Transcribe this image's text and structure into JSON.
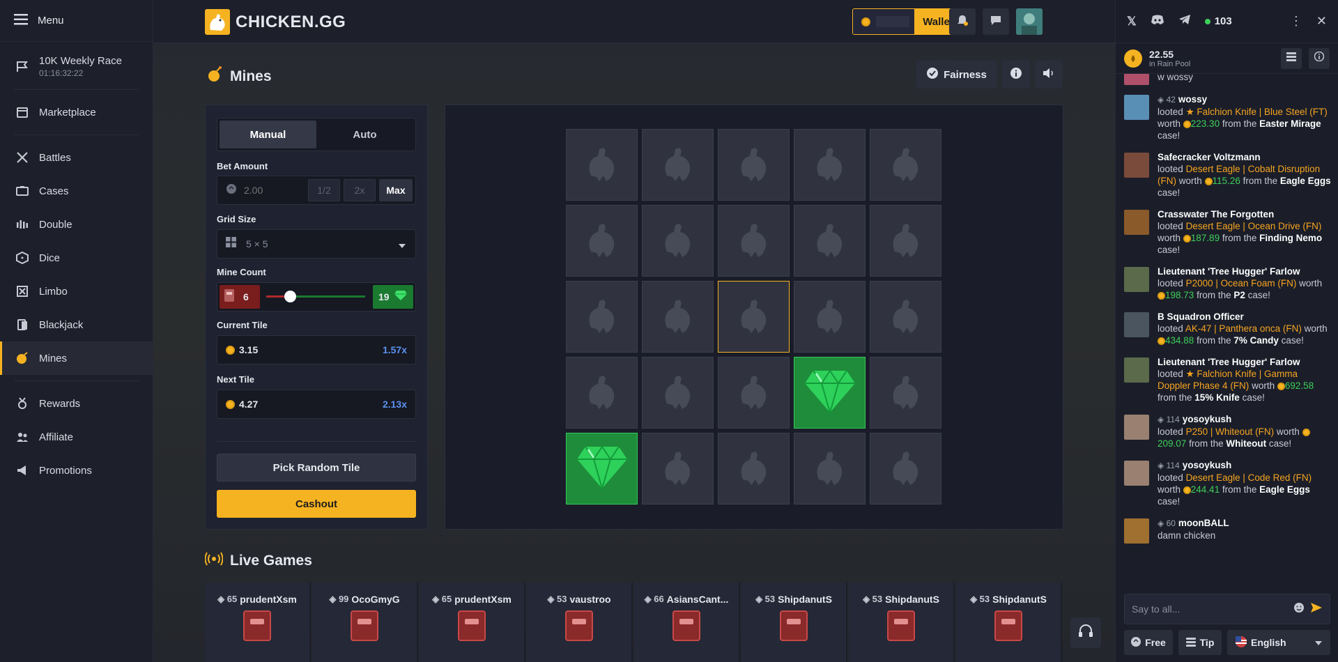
{
  "sidebar": {
    "menu_label": "Menu",
    "race": {
      "label": "10K Weekly Race",
      "timer": "01:16:32:22"
    },
    "items": [
      {
        "label": "Marketplace",
        "icon": "store-icon"
      },
      {
        "label": "Battles",
        "icon": "swords-icon"
      },
      {
        "label": "Cases",
        "icon": "case-icon"
      },
      {
        "label": "Double",
        "icon": "bars-icon"
      },
      {
        "label": "Dice",
        "icon": "dice-icon"
      },
      {
        "label": "Limbo",
        "icon": "limbo-icon"
      },
      {
        "label": "Blackjack",
        "icon": "cards-icon"
      },
      {
        "label": "Mines",
        "icon": "bomb-icon",
        "active": true
      },
      {
        "label": "Rewards",
        "icon": "medal-icon"
      },
      {
        "label": "Affiliate",
        "icon": "users-icon"
      },
      {
        "label": "Promotions",
        "icon": "megaphone-icon"
      }
    ]
  },
  "header": {
    "logo_text": "CHICKEN.GG",
    "wallet_label": "Wallet"
  },
  "game": {
    "title": "Mines",
    "fairness_label": "Fairness",
    "tabs": [
      "Manual",
      "Auto"
    ],
    "bet_label": "Bet Amount",
    "bet_placeholder": "2.00",
    "half_label": "1/2",
    "double_label": "2x",
    "max_label": "Max",
    "grid_label": "Grid Size",
    "grid_value": "5 × 5",
    "mine_label": "Mine Count",
    "mines": "6",
    "gems": "19",
    "mine_fraction": 0.24,
    "current_label": "Current Tile",
    "current_value": "3.15",
    "current_mult": "1.57x",
    "next_label": "Next Tile",
    "next_value": "4.27",
    "next_mult": "2.13x",
    "random_label": "Pick Random Tile",
    "cashout_label": "Cashout",
    "gem_tiles": [
      18,
      20
    ],
    "highlight_tile": 12
  },
  "live": {
    "title": "Live Games",
    "games": [
      {
        "level": "65",
        "name": "prudentXsm"
      },
      {
        "level": "99",
        "name": "OcoGmyG"
      },
      {
        "level": "65",
        "name": "prudentXsm"
      },
      {
        "level": "53",
        "name": "vaustroo"
      },
      {
        "level": "66",
        "name": "AsiansCant..."
      },
      {
        "level": "53",
        "name": "ShipdanutS"
      },
      {
        "level": "53",
        "name": "ShipdanutS"
      },
      {
        "level": "53",
        "name": "ShipdanutS"
      }
    ]
  },
  "chat": {
    "online": "103",
    "rain_amount": "22.55",
    "rain_label": "in Rain Pool",
    "first_line": "w wossy",
    "messages": [
      {
        "level": "42",
        "user": "wossy",
        "item": "★ Falchion Knife | Blue Steel (FT)",
        "value": "223.30",
        "case": "Easter Mirage",
        "avatar": "#5a8fb5"
      },
      {
        "level": "",
        "user": "Safecracker Voltzmann",
        "item": "Desert Eagle | Cobalt Disruption (FN)",
        "value": "115.26",
        "case": "Eagle Eggs",
        "avatar": "#7a4a3a"
      },
      {
        "level": "",
        "user": "Crasswater The Forgotten",
        "item": "Desert Eagle | Ocean Drive (FN)",
        "value": "187.89",
        "case": "Finding Nemo",
        "avatar": "#8a5a2a"
      },
      {
        "level": "",
        "user": "Lieutenant 'Tree Hugger' Farlow",
        "item": "P2000 | Ocean Foam (FN)",
        "value": "198.73",
        "case": "P2",
        "avatar": "#5a6a4a"
      },
      {
        "level": "",
        "user": "B Squadron Officer",
        "item": "AK-47 | Panthera onca (FN)",
        "value": "434.88",
        "case": "7% Candy",
        "avatar": "#4a5560"
      },
      {
        "level": "",
        "user": "Lieutenant 'Tree Hugger' Farlow",
        "item": "★ Falchion Knife | Gamma Doppler Phase 4 (FN)",
        "value": "692.58",
        "case": "15% Knife",
        "avatar": "#5a6a4a"
      },
      {
        "level": "114",
        "user": "yosoykush",
        "item": "P250 | Whiteout (FN)",
        "value": "209.07",
        "case": "Whiteout",
        "avatar": "#9a8070"
      },
      {
        "level": "114",
        "user": "yosoykush",
        "item": "Desert Eagle | Code Red (FN)",
        "value": "244.41",
        "case": "Eagle Eggs",
        "avatar": "#9a8070"
      }
    ],
    "looted": "looted",
    "worth": "worth",
    "from_the": "from the",
    "case_word": "case!",
    "last": {
      "level": "60",
      "user": "moonBALL",
      "text": "damn chicken"
    },
    "input_placeholder": "Say to all...",
    "free_label": "Free",
    "tip_label": "Tip",
    "language": "English"
  }
}
